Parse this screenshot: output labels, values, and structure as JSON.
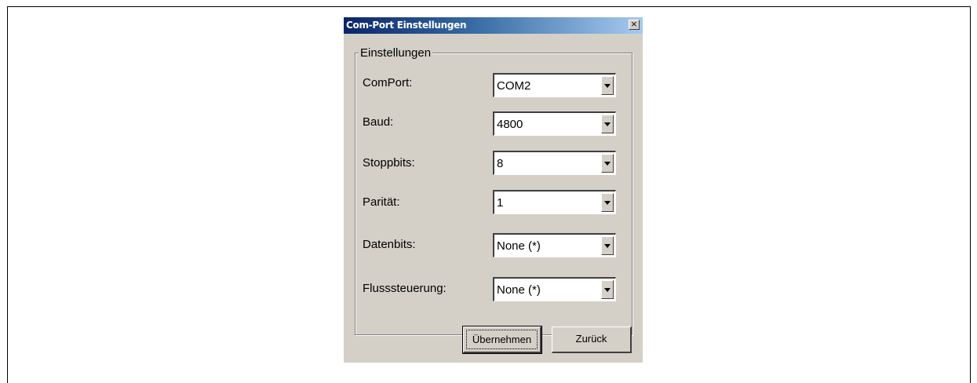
{
  "dialog": {
    "title": "Com-Port Einstellungen",
    "close_glyph": "×",
    "group_label": "Einstellungen",
    "rows": [
      {
        "label": "ComPort:",
        "value": "COM2"
      },
      {
        "label": "Baud:",
        "value": "4800"
      },
      {
        "label": "Stoppbits:",
        "value": "8"
      },
      {
        "label": "Parität:",
        "value": "1"
      },
      {
        "label": "Datenbits:",
        "value": "None (*)"
      },
      {
        "label": "Flusssteuerung:",
        "value": "None (*)"
      }
    ],
    "apply_label": "Übernehmen",
    "back_label": "Zurück"
  }
}
